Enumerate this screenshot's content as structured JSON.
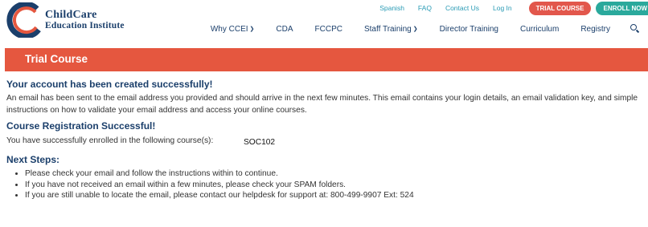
{
  "logo": {
    "line1": "ChildCare",
    "line2": "Education Institute"
  },
  "utility_links": [
    "Spanish",
    "FAQ",
    "Contact Us",
    "Log In"
  ],
  "buttons": {
    "trial": "TRIAL COURSE",
    "enroll": "ENROLL NOW"
  },
  "nav": {
    "items": [
      "Why CCEI",
      "CDA",
      "FCCPC",
      "Staff Training",
      "Director Training",
      "Curriculum",
      "Registry"
    ],
    "search_icon": "search-icon"
  },
  "banner": {
    "title": "Trial Course"
  },
  "content": {
    "account_heading": "Your account has been created successfully!",
    "account_text": "An email has been sent to the email address you provided and should arrive in the next few minutes. This email contains your login details, an email validation key, and simple instructions on how to validate your email address and access your online courses.",
    "registration_heading": "Course Registration Successful!",
    "enrolled_text": "You have successfully enrolled in the following course(s):",
    "course_code": "SOC102",
    "next_heading": "Next Steps:",
    "steps": [
      "Please check your email and follow the instructions within to continue.",
      "If you have not received an email within a few minutes, please check your SPAM folders.",
      "If you are still unable to locate the email, please contact our helpdesk for support at: 800-499-9907 Ext: 524"
    ]
  },
  "colors": {
    "navy": "#1b3f6b",
    "banner": "#e5573f",
    "trial_button": "#e2574c",
    "enroll_button": "#2aa99c",
    "link": "#2a9bb5"
  }
}
